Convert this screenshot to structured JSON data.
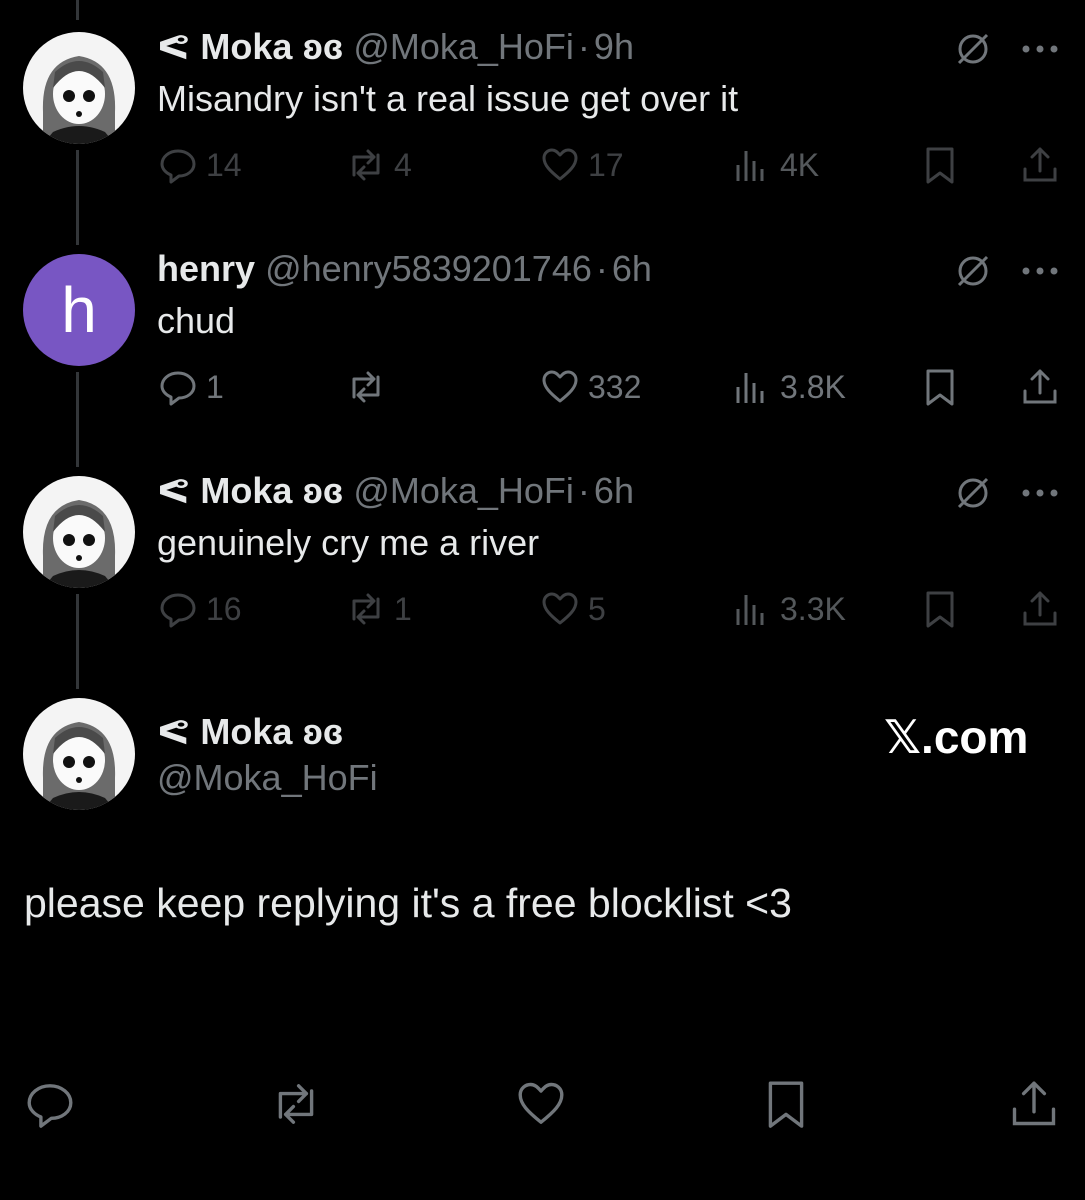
{
  "tweets": [
    {
      "name": "ᕙ Moka ʚɞ",
      "handle": "@Moka_HoFi",
      "time": "9h",
      "text": "Misandry isn't a real issue get over it",
      "replies": "14",
      "reposts": "4",
      "likes": "17",
      "views": "4K"
    },
    {
      "name": "henry",
      "handle": "@henry5839201746",
      "time": "6h",
      "avatar_letter": "h",
      "text": "chud",
      "replies": "1",
      "reposts": "",
      "likes": "332",
      "views": "3.8K"
    },
    {
      "name": "ᕙ Moka ʚɞ",
      "handle": "@Moka_HoFi",
      "time": "6h",
      "text": "genuinely cry me a river",
      "replies": "16",
      "reposts": "1",
      "likes": "5",
      "views": "3.3K"
    }
  ],
  "main_tweet": {
    "name": "ᕙ Moka ʚɞ",
    "handle": "@Moka_HoFi",
    "brand": "𝕏.com",
    "text": "please keep replying it's a free blocklist <3"
  },
  "dot": "·",
  "colors": {
    "background": "#000000",
    "text": "#e7e9ea",
    "muted": "#71767b",
    "henry_avatar": "#7856c3"
  }
}
